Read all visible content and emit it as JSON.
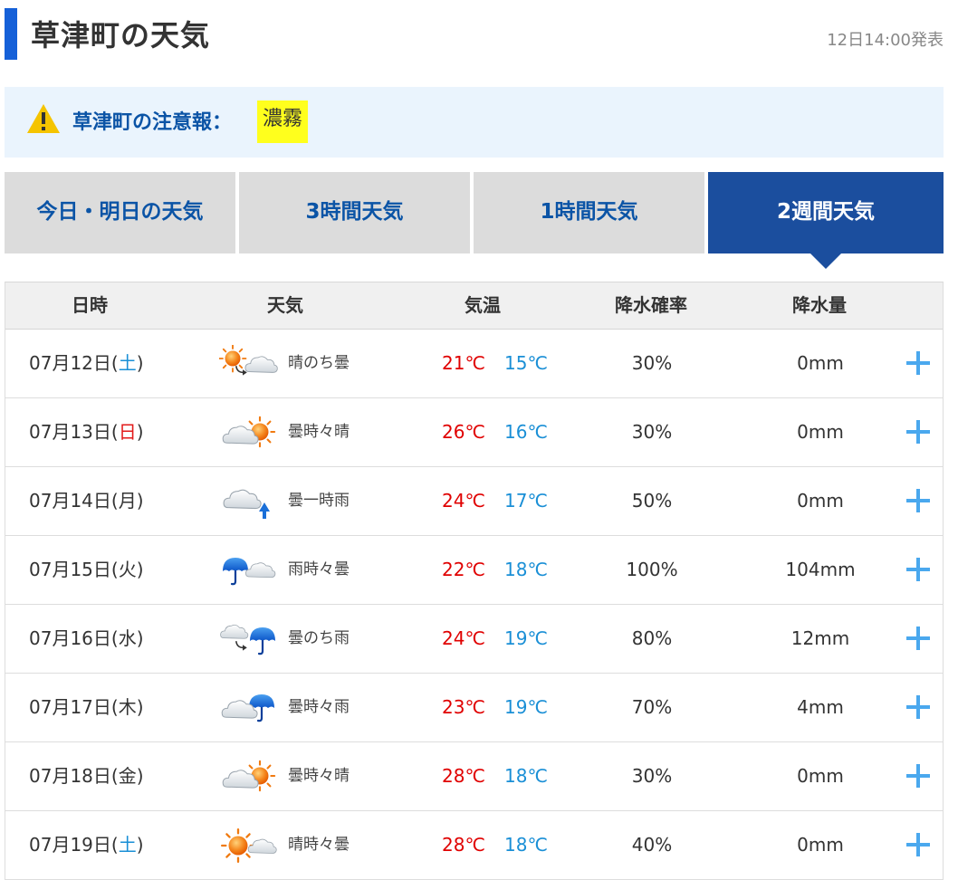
{
  "header": {
    "title": "草津町の天気",
    "published": "12日14:00発表"
  },
  "warning": {
    "label": "草津町の注意報：",
    "badge": "濃霧",
    "icon": "warning-triangle-icon"
  },
  "tabs": [
    {
      "label": "今日・明日の天気",
      "active": false
    },
    {
      "label": "3時間天気",
      "active": false
    },
    {
      "label": "1時間天気",
      "active": false
    },
    {
      "label": "2週間天気",
      "active": true
    }
  ],
  "table": {
    "headers": {
      "date": "日時",
      "weather": "天気",
      "temp": "気温",
      "prob": "降水確率",
      "amount": "降水量"
    },
    "rows": [
      {
        "date": "07月12日(",
        "dow": "土",
        "dow_type": "sat",
        "close": ")",
        "icon": "sunny-then-cloudy-icon",
        "weather": "晴のち曇",
        "max": "21℃",
        "min": "15℃",
        "prob": "30%",
        "amount": "0mm"
      },
      {
        "date": "07月13日(",
        "dow": "日",
        "dow_type": "sun",
        "close": ")",
        "icon": "cloudy-sometimes-sunny-icon",
        "weather": "曇時々晴",
        "max": "26℃",
        "min": "16℃",
        "prob": "30%",
        "amount": "0mm"
      },
      {
        "date": "07月14日(",
        "dow": "月",
        "dow_type": "",
        "close": ")",
        "icon": "cloudy-occasional-rain-icon",
        "weather": "曇一時雨",
        "max": "24℃",
        "min": "17℃",
        "prob": "50%",
        "amount": "0mm"
      },
      {
        "date": "07月15日(",
        "dow": "火",
        "dow_type": "",
        "close": ")",
        "icon": "rain-sometimes-cloudy-icon",
        "weather": "雨時々曇",
        "max": "22℃",
        "min": "18℃",
        "prob": "100%",
        "amount": "104mm"
      },
      {
        "date": "07月16日(",
        "dow": "水",
        "dow_type": "",
        "close": ")",
        "icon": "cloudy-then-rain-icon",
        "weather": "曇のち雨",
        "max": "24℃",
        "min": "19℃",
        "prob": "80%",
        "amount": "12mm"
      },
      {
        "date": "07月17日(",
        "dow": "木",
        "dow_type": "",
        "close": ")",
        "icon": "cloudy-sometimes-rain-icon",
        "weather": "曇時々雨",
        "max": "23℃",
        "min": "19℃",
        "prob": "70%",
        "amount": "4mm"
      },
      {
        "date": "07月18日(",
        "dow": "金",
        "dow_type": "",
        "close": ")",
        "icon": "cloudy-sometimes-sunny-icon",
        "weather": "曇時々晴",
        "max": "28℃",
        "min": "18℃",
        "prob": "30%",
        "amount": "0mm"
      },
      {
        "date": "07月19日(",
        "dow": "土",
        "dow_type": "sat",
        "close": ")",
        "icon": "sunny-sometimes-cloudy-icon",
        "weather": "晴時々曇",
        "max": "28℃",
        "min": "18℃",
        "prob": "40%",
        "amount": "0mm"
      }
    ]
  },
  "colors": {
    "accent": "#1560d8",
    "tab_active": "#1b4e9e",
    "tab_inactive": "#dcdcdc",
    "max_temp": "#e00000",
    "min_temp": "#1a8fd6",
    "saturday": "#1a8fd6",
    "sunday": "#e21a1a",
    "warning_badge": "#ffff1d",
    "plus": "#4aa8ee"
  }
}
